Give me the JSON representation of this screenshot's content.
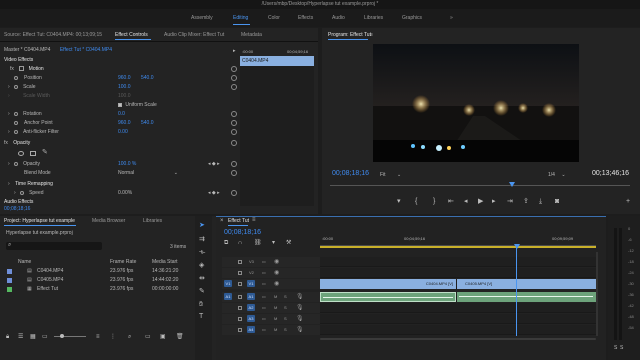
{
  "window": {
    "title": "/Users/mbp/Desktop/Hyperlapse tut example.prproj *"
  },
  "workspaces": [
    "Assembly",
    "Editing",
    "Color",
    "Effects",
    "Audio",
    "Libraries",
    "Graphics"
  ],
  "workspace_active": "Editing",
  "more_workspaces": "»",
  "source_panel": {
    "tabs": [
      "Source: Effect Tut: C0404.MP4: 00;13;09;15",
      "Effect Controls",
      "Audio Clip Mixer: Effect Tut",
      "Metadata"
    ],
    "breadcrumb_master": "Master * C0404.MP4",
    "breadcrumb_clip": "Effect Tut * C0404.MP4",
    "mini_time_start": ":00:00",
    "mini_time_end": "00;04;59;16",
    "clip_label": "C0404.MP4",
    "video_effects": "Video Effects",
    "motion": "Motion",
    "position_label": "Position",
    "position_x": "960.0",
    "position_y": "540.0",
    "scale_label": "Scale",
    "scale_value": "100.0",
    "scale_width_label": "Scale Width",
    "scale_width_value": "100.0",
    "uniform_scale": "Uniform Scale",
    "rotation_label": "Rotation",
    "rotation_value": "0.0",
    "anchor_label": "Anchor Point",
    "anchor_x": "960.0",
    "anchor_y": "540.0",
    "antiflicker_label": "Anti-flicker Filter",
    "antiflicker_value": "0.00",
    "opacity_section": "Opacity",
    "opacity_label": "Opacity",
    "opacity_value": "100.0 %",
    "blend_label": "Blend Mode",
    "blend_value": "Normal",
    "time_remap": "Time Remapping",
    "speed_label": "Speed",
    "speed_value": "0.00%",
    "audio_effects": "Audio Effects",
    "current_time": "00;08;18;16"
  },
  "program_panel": {
    "title": "Program: Effect Tut",
    "timecode": "00;08;18;16",
    "fit": "Fit",
    "resolution": "1/4",
    "duration": "00;13;46;16"
  },
  "project_panel": {
    "tabs": [
      "Project: Hyperlapse tut example",
      "Media Browser",
      "Libraries"
    ],
    "project_file": "Hyperlapse tut example.prproj",
    "item_count": "3 items",
    "columns": [
      "Name",
      "Frame Rate",
      "Media Start"
    ],
    "items": [
      {
        "name": "C0404.MP4",
        "fps": "23.976 fps",
        "start": "14:36:21:20",
        "color": "#6f8fd8"
      },
      {
        "name": "C0405.MP4",
        "fps": "23.976 fps",
        "start": "14:44:02:20",
        "color": "#6f8fd8"
      },
      {
        "name": "Effect Tut",
        "fps": "23.976 fps",
        "start": "00:00:00:00",
        "color": "#55b860"
      }
    ]
  },
  "timeline": {
    "tab": "Effect Tut",
    "timecode": "00;08;18;16",
    "ruler_ticks": [
      ":00:00",
      "00;04;59;16",
      "00;09;59;09"
    ],
    "video_tracks": [
      "V3",
      "V2",
      "V1"
    ],
    "audio_tracks": [
      "A1",
      "A2",
      "A3",
      "A4"
    ],
    "source_patch_v": "V1",
    "source_patch_a": "A1",
    "clip_1": "C0404.MP4 [V]",
    "clip_2": "C0405.MP4 [V]"
  },
  "meters": {
    "labels": [
      "0",
      "-6",
      "-12",
      "-18",
      "-24",
      "-30",
      "-36",
      "-42",
      "-48",
      "-54"
    ]
  },
  "colors": {
    "accent": "#4a95f0",
    "clip_video": "#8ab0e0",
    "clip_audio": "#6da37b"
  }
}
